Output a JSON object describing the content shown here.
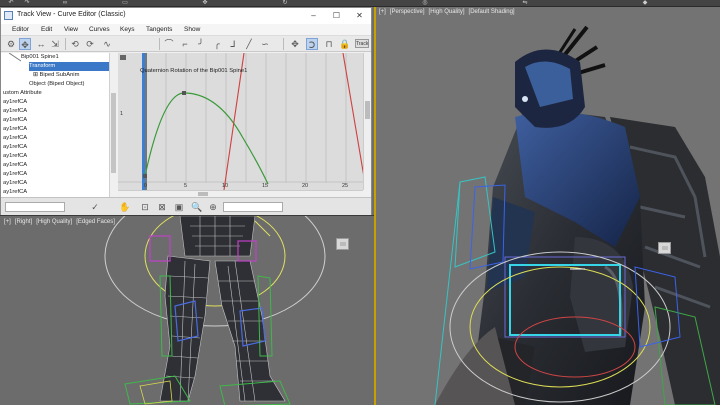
{
  "track_view": {
    "title": "Track View - Curve Editor (Classic)",
    "window_buttons": [
      "–",
      "☐",
      "✕"
    ],
    "menu": [
      "Editor",
      "Edit",
      "View",
      "Curves",
      "Keys",
      "Tangents",
      "Show"
    ],
    "toolbar_track_label": "Track",
    "tree_items": [
      {
        "label": "Bip001 Spine1",
        "selected": false
      },
      {
        "label": "Transform",
        "selected": true
      },
      {
        "label": "⊞ Biped SubAnim",
        "selected": false
      },
      {
        "label": "Object (Biped Object)",
        "selected": false
      },
      {
        "label": "ustom Attribute",
        "selected": false
      },
      {
        "label": "ay1refCA",
        "selected": false
      },
      {
        "label": "ay1refCA",
        "selected": false
      },
      {
        "label": "ay1refCA",
        "selected": false
      },
      {
        "label": "ay1refCA",
        "selected": false
      },
      {
        "label": "ay1refCA",
        "selected": false
      },
      {
        "label": "ay1refCA",
        "selected": false
      },
      {
        "label": "ay1refCA",
        "selected": false
      },
      {
        "label": "ay1refCA",
        "selected": false
      },
      {
        "label": "ay1refCA",
        "selected": false
      },
      {
        "label": "ay1refCA",
        "selected": false
      },
      {
        "label": "ay1refCA",
        "selected": false
      }
    ],
    "graph": {
      "curve_title": "Quaternion Rotation of the Bip001 Spine1",
      "y_value_label": "1",
      "x_ticks": [
        "0",
        "5",
        "10",
        "15",
        "20",
        "25"
      ]
    }
  },
  "viewport_right": {
    "labels": [
      "[+]",
      "[Perspective]",
      "[High Quality]",
      "[Default Shading]"
    ]
  },
  "viewport_left": {
    "labels": [
      "[+]",
      "[Right]",
      "[High Quality]",
      "[Edged Faces]"
    ]
  },
  "colors": {
    "selection_blue": "#3b78c8",
    "curve_green": "#3a9a3a",
    "curve_red": "#d04040",
    "time_slider_blue": "#3a7fd4",
    "viewport_gray": "#737373",
    "active_frame": "#c8a000"
  }
}
